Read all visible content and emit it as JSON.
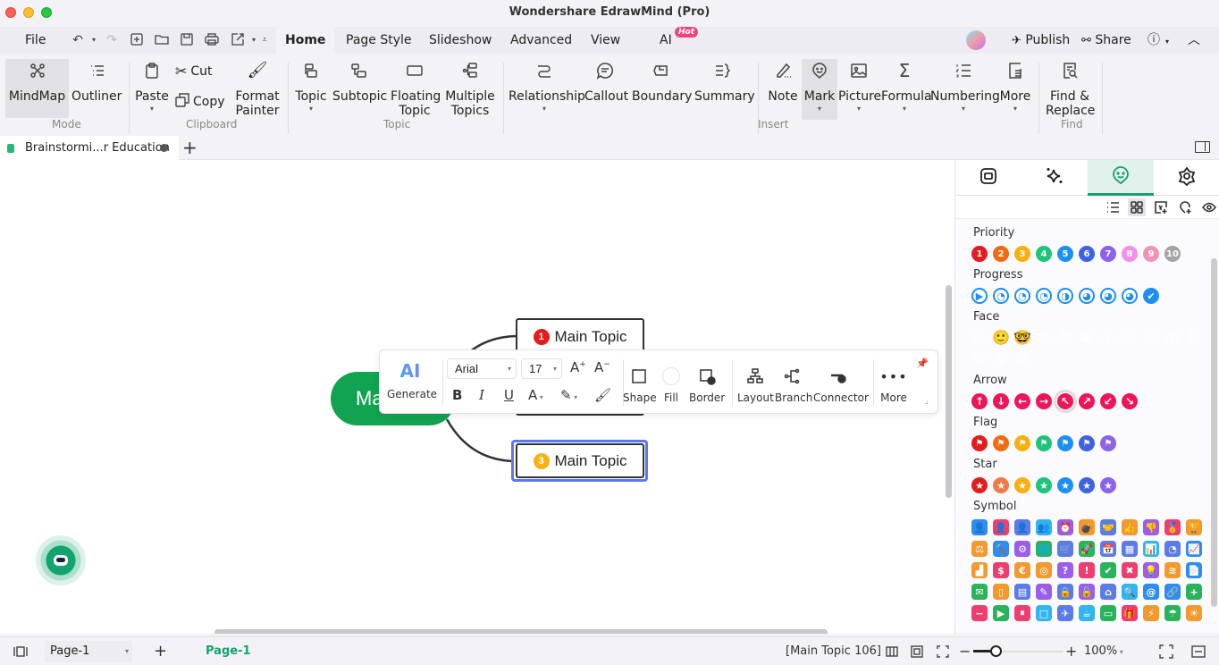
{
  "window": {
    "title": "Wondershare EdrawMind (Pro)"
  },
  "menubar": {
    "file": "File",
    "tabs": [
      {
        "label": "Home",
        "active": true
      },
      {
        "label": "Page Style"
      },
      {
        "label": "Slideshow"
      },
      {
        "label": "Advanced"
      },
      {
        "label": "View"
      },
      {
        "label": "AI",
        "badge": "Hot"
      }
    ],
    "publish": "Publish",
    "share": "Share"
  },
  "ribbon": {
    "mode": {
      "label": "Mode",
      "items": [
        "MindMap",
        "Outliner"
      ]
    },
    "clipboard": {
      "label": "Clipboard",
      "paste": "Paste",
      "cut": "Cut",
      "copy": "Copy",
      "format_painter": [
        "Format",
        "Painter"
      ]
    },
    "topic": {
      "label": "Topic",
      "topic": "Topic",
      "subtopic": "Subtopic",
      "floating": [
        "Floating",
        "Topic"
      ],
      "multiple": [
        "Multiple",
        "Topics"
      ]
    },
    "insert": {
      "label": "Insert",
      "relationship": "Relationship",
      "callout": "Callout",
      "boundary": "Boundary",
      "summary": "Summary",
      "note": "Note",
      "mark": "Mark",
      "picture": "Picture",
      "formula": "Formula",
      "numbering": "Numbering",
      "more": "More"
    },
    "find": {
      "label": "Find",
      "find_replace": [
        "Find &",
        "Replace"
      ]
    }
  },
  "document": {
    "tab_title": "Brainstormi...r Education"
  },
  "canvas": {
    "central_topic": "Ma",
    "topics": [
      {
        "label": "Main Topic",
        "priority": "1",
        "color": "#e81a1a"
      },
      {
        "label": "Main Topic",
        "priority": "3",
        "color": "#f5b316",
        "selected": true
      }
    ]
  },
  "floating_toolbar": {
    "generate": "Generate",
    "ai_label": "AI",
    "font": "Arial",
    "size": "17",
    "shape": "Shape",
    "fill": "Fill",
    "border": "Border",
    "layout": "Layout",
    "branch": "Branch",
    "connector": "Connector",
    "more": "More"
  },
  "panel": {
    "sections": {
      "priority": "Priority",
      "progress": "Progress",
      "face": "Face",
      "arrow": "Arrow",
      "flag": "Flag",
      "star": "Star",
      "symbol": "Symbol"
    },
    "priority_marks": [
      {
        "t": "1",
        "c": "#e11d1d"
      },
      {
        "t": "2",
        "c": "#f26b0f"
      },
      {
        "t": "3",
        "c": "#f7b010"
      },
      {
        "t": "4",
        "c": "#1ec47a"
      },
      {
        "t": "5",
        "c": "#1e8ff2"
      },
      {
        "t": "6",
        "c": "#3f63e0"
      },
      {
        "t": "7",
        "c": "#8a63ea"
      },
      {
        "t": "8",
        "c": "#ef90ea"
      },
      {
        "t": "9",
        "c": "#f092b4"
      },
      {
        "t": "10",
        "c": "#a3a3a3"
      }
    ],
    "progress_marks": [
      "▶",
      "◔",
      "◔",
      "◔",
      "◑",
      "◕",
      "◕",
      "◕",
      "✔"
    ],
    "face_marks": [
      "😄",
      "🙂",
      "🤓",
      "😟",
      "😠",
      "😭",
      "😮",
      "😕",
      "😒",
      "😱",
      "😷",
      "😆",
      "😵",
      "😍"
    ],
    "arrow_marks": [
      "↑",
      "↓",
      "←",
      "→",
      "↖",
      "↗",
      "↙",
      "↘"
    ],
    "flag_colors": [
      "#e11d1d",
      "#f26b0f",
      "#f7b010",
      "#1ec47a",
      "#1e8ff2",
      "#3f63e0",
      "#8a63ea"
    ],
    "star_colors": [
      "#e11d1d",
      "#f07a4a",
      "#f7b010",
      "#1ec47a",
      "#1e8ff2",
      "#3f63e0",
      "#8a63ea"
    ],
    "symbol_marks": [
      {
        "g": "👤",
        "c": "#2f8cf0"
      },
      {
        "g": "👤",
        "c": "#ee3e6e"
      },
      {
        "g": "👤",
        "c": "#5b7be8"
      },
      {
        "g": "👥",
        "c": "#30b5ee"
      },
      {
        "g": "⏰",
        "c": "#9b5ee8"
      },
      {
        "g": "💣",
        "c": "#f29a2e"
      },
      {
        "g": "🤝",
        "c": "#5b7be8"
      },
      {
        "g": "👍",
        "c": "#f29a2e"
      },
      {
        "g": "👎",
        "c": "#9b5ee8"
      },
      {
        "g": "🏅",
        "c": "#ee3e6e"
      },
      {
        "g": "🏆",
        "c": "#f29a2e"
      },
      {
        "g": "⚖",
        "c": "#f29a2e"
      },
      {
        "g": "🔨",
        "c": "#2f8cf0"
      },
      {
        "g": "⚙",
        "c": "#9b5ee8"
      },
      {
        "g": "🌐",
        "c": "#2bb35c"
      },
      {
        "g": "🛒",
        "c": "#5b7be8"
      },
      {
        "g": "🚀",
        "c": "#2bb35c"
      },
      {
        "g": "📅",
        "c": "#5b7be8"
      },
      {
        "g": "▦",
        "c": "#5b7be8"
      },
      {
        "g": "📊",
        "c": "#30b5ee"
      },
      {
        "g": "◔",
        "c": "#5b7be8"
      },
      {
        "g": "📈",
        "c": "#2f8cf0"
      },
      {
        "g": "▟",
        "c": "#f29a2e"
      },
      {
        "g": "$",
        "c": "#ee3e6e"
      },
      {
        "g": "€",
        "c": "#f29a2e"
      },
      {
        "g": "◎",
        "c": "#f29a2e"
      },
      {
        "g": "?",
        "c": "#9b5ee8"
      },
      {
        "g": "!",
        "c": "#ee3e6e"
      },
      {
        "g": "✔",
        "c": "#2bb35c"
      },
      {
        "g": "✖",
        "c": "#ee3e6e"
      },
      {
        "g": "💡",
        "c": "#9b5ee8"
      },
      {
        "g": "≋",
        "c": "#f29a2e"
      },
      {
        "g": "📄",
        "c": "#2f8cf0"
      },
      {
        "g": "✉",
        "c": "#2bb35c"
      },
      {
        "g": "▯",
        "c": "#f29a2e"
      },
      {
        "g": "▤",
        "c": "#5b7be8"
      },
      {
        "g": "✎",
        "c": "#9b5ee8"
      },
      {
        "g": "🔒",
        "c": "#5b7be8"
      },
      {
        "g": "🔓",
        "c": "#9b5ee8"
      },
      {
        "g": "⌂",
        "c": "#5b7be8"
      },
      {
        "g": "🔍",
        "c": "#30b5ee"
      },
      {
        "g": "@",
        "c": "#2f8cf0"
      },
      {
        "g": "🔗",
        "c": "#2f8cf0"
      },
      {
        "g": "+",
        "c": "#2bb35c"
      },
      {
        "g": "−",
        "c": "#ee3e6e"
      },
      {
        "g": "▶",
        "c": "#2bb35c"
      },
      {
        "g": "⏸",
        "c": "#ee3e6e"
      },
      {
        "g": "□",
        "c": "#30b5ee"
      },
      {
        "g": "✈",
        "c": "#5b7be8"
      },
      {
        "g": "☕",
        "c": "#30b5ee"
      },
      {
        "g": "▭",
        "c": "#2bb35c"
      },
      {
        "g": "🎁",
        "c": "#ee3e6e"
      },
      {
        "g": "⚡",
        "c": "#f29a2e"
      },
      {
        "g": "☂",
        "c": "#2bb35c"
      },
      {
        "g": "☀",
        "c": "#f29a2e"
      }
    ]
  },
  "statusbar": {
    "page_select": "Page-1",
    "active_page": "Page-1",
    "selection_info": "[Main Topic 106]",
    "zoom": "100%",
    "zoom_level_percent": 100
  }
}
